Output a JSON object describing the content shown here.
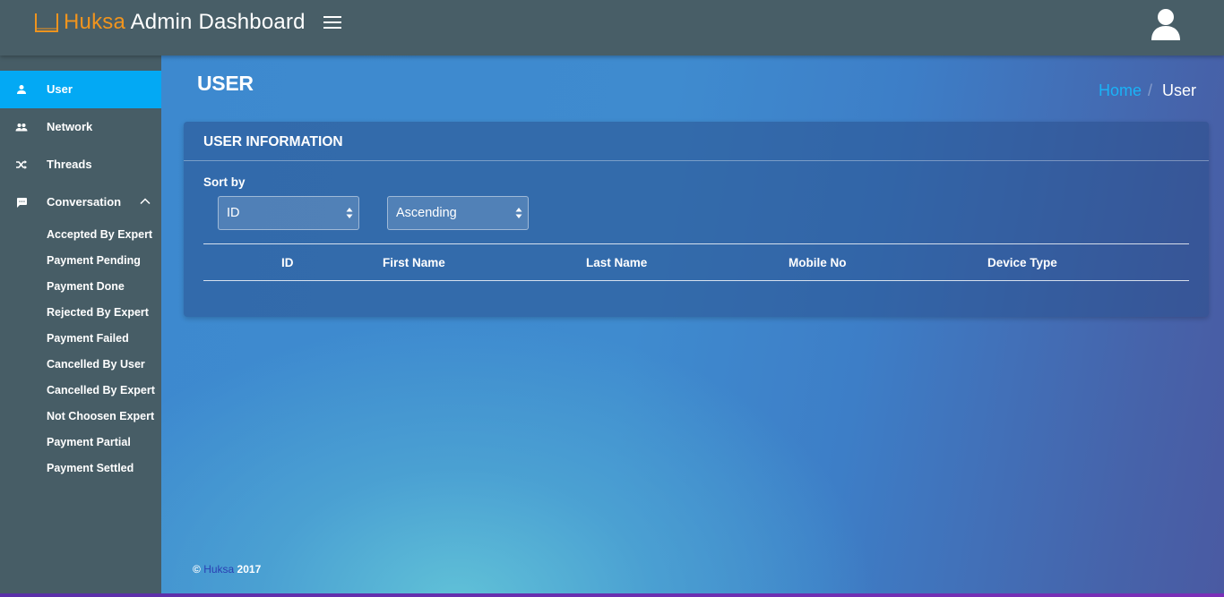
{
  "header": {
    "brand_accent": "Huksa",
    "brand_rest": " Admin Dashboard",
    "brand_color": "#f0941e",
    "menu_icon": "hamburger-icon",
    "user_icon": "user-avatar-icon"
  },
  "sidebar": {
    "active_color": "#03a9f4",
    "items": [
      {
        "label": "User",
        "icon": "person-icon",
        "active": true
      },
      {
        "label": "Network",
        "icon": "people-icon",
        "active": false
      },
      {
        "label": "Threads",
        "icon": "shuffle-icon",
        "active": false
      },
      {
        "label": "Conversation",
        "icon": "chat-icon",
        "active": false,
        "expanded": true
      }
    ],
    "conversation_subitems": [
      "Accepted By Expert",
      "Payment Pending",
      "Payment Done",
      "Rejected By Expert",
      "Payment Failed",
      "Cancelled By User",
      "Cancelled By Expert",
      "Not Choosen Expert",
      "Payment Partial",
      "Payment Settled"
    ]
  },
  "main": {
    "page_title": "USER",
    "breadcrumb": {
      "home": "Home",
      "separator": "/",
      "current": "User"
    },
    "card": {
      "title": "USER INFORMATION",
      "sort_label": "Sort by",
      "sort_field": "ID",
      "sort_order": "Ascending",
      "columns": [
        "ID",
        "First Name",
        "Last Name",
        "Mobile No",
        "Device Type"
      ]
    },
    "footer": {
      "copyright": "©",
      "brand": "Huksa",
      "year": "2017"
    }
  }
}
